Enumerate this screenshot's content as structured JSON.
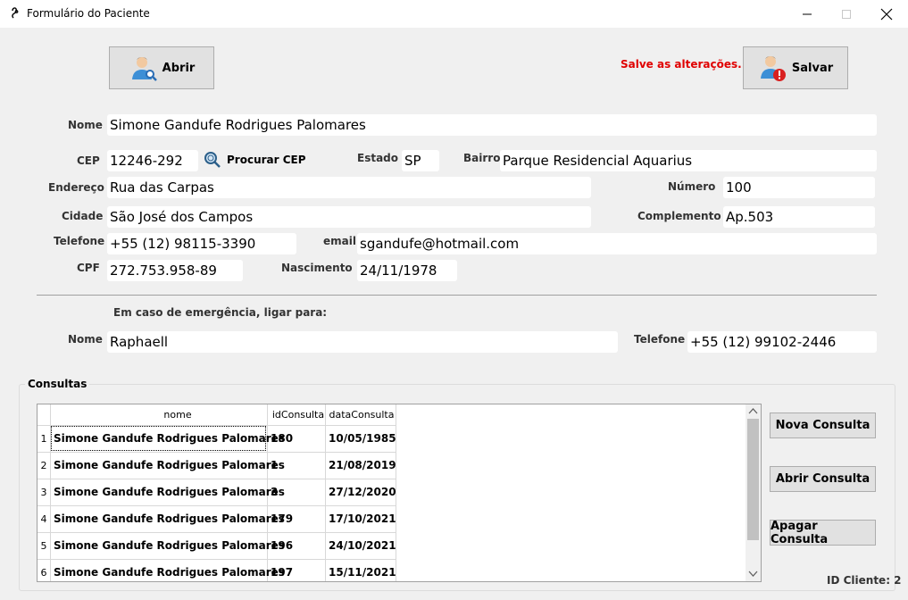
{
  "window": {
    "title": "Formulário do Paciente"
  },
  "toolbar": {
    "open_label": "Abrir",
    "save_label": "Salvar",
    "save_warning": "Salve as alterações...",
    "warning_color": "#e00000"
  },
  "patient": {
    "nome_label": "Nome",
    "nome": "Simone Gandufe Rodrigues Palomares",
    "cep_label": "CEP",
    "cep": "12246-292",
    "procurar_cep": "Procurar CEP",
    "estado_label": "Estado",
    "estado": "SP",
    "bairro_label": "Bairro",
    "bairro": "Parque Residencial Aquarius",
    "endereco_label": "Endereço",
    "endereco": "Rua das Carpas",
    "numero_label": "Número",
    "numero": "100",
    "cidade_label": "Cidade",
    "cidade": "São José dos Campos",
    "complemento_label": "Complemento",
    "complemento": "Ap.503",
    "telefone_label": "Telefone",
    "telefone": "+55 (12) 98115-3390",
    "email_label": "email",
    "email": "sgandufe@hotmail.com",
    "cpf_label": "CPF",
    "cpf": "272.753.958-89",
    "nascimento_label": "Nascimento",
    "nascimento": "24/11/1978"
  },
  "emergency": {
    "heading": "Em caso de emergência, ligar para:",
    "nome_label": "Nome",
    "nome": "Raphaell",
    "telefone_label": "Telefone",
    "telefone": "+55 (12) 99102-2446"
  },
  "consultas": {
    "group_label": "Consultas",
    "columns": [
      "nome",
      "idConsulta",
      "dataConsulta"
    ],
    "rows": [
      {
        "num": "1",
        "nome": "Simone Gandufe Rodrigues Palomares",
        "id": "180",
        "data": "10/05/1985"
      },
      {
        "num": "2",
        "nome": "Simone Gandufe Rodrigues Palomares",
        "id": "1",
        "data": "21/08/2019"
      },
      {
        "num": "3",
        "nome": "Simone Gandufe Rodrigues Palomares",
        "id": "3",
        "data": "27/12/2020"
      },
      {
        "num": "4",
        "nome": "Simone Gandufe Rodrigues Palomares",
        "id": "179",
        "data": "17/10/2021"
      },
      {
        "num": "5",
        "nome": "Simone Gandufe Rodrigues Palomares",
        "id": "196",
        "data": "24/10/2021"
      },
      {
        "num": "6",
        "nome": "Simone Gandufe Rodrigues Palomares",
        "id": "197",
        "data": "15/11/2021"
      }
    ],
    "nova_label": "Nova Consulta",
    "abrir_label": "Abrir Consulta",
    "apagar_label": "Apagar Consulta"
  },
  "footer": {
    "id_cliente": "ID Cliente: 2"
  }
}
